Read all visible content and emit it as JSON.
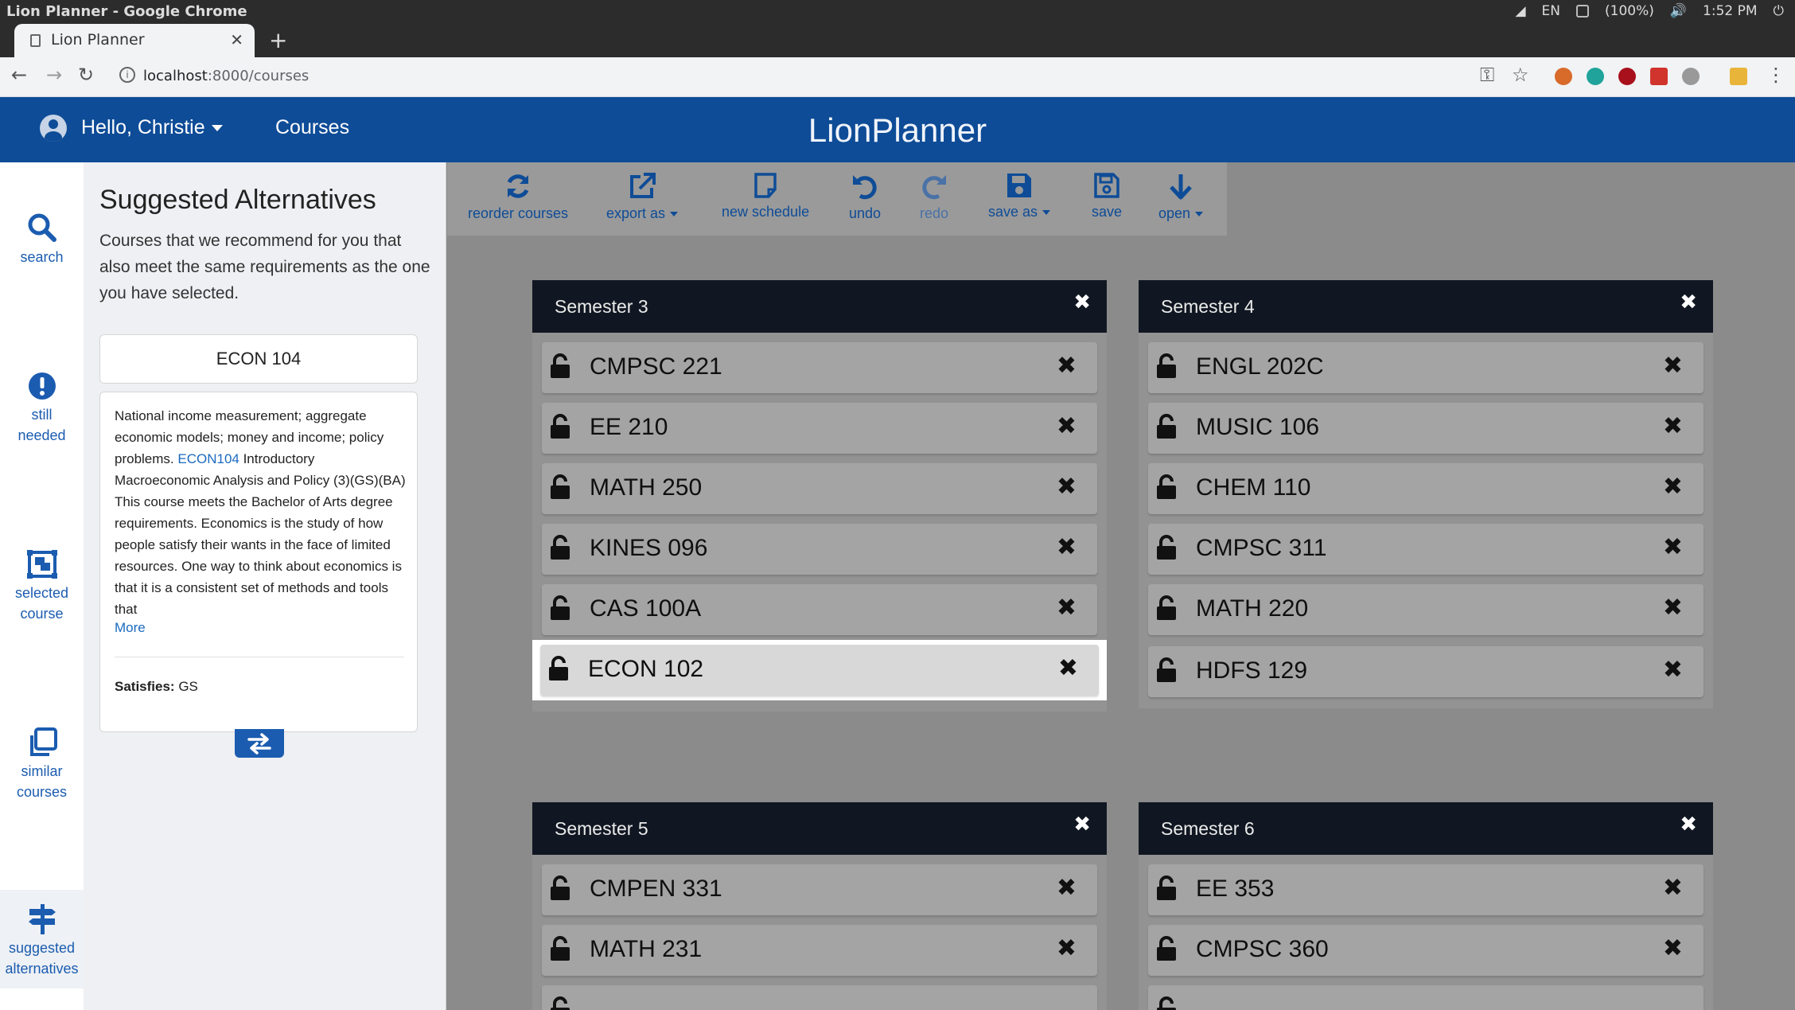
{
  "os": {
    "window_title": "Lion Planner - Google Chrome",
    "lang": "EN",
    "battery": "(100%)",
    "time": "1:52 PM"
  },
  "browser": {
    "tab_title": "Lion Planner",
    "url_host": "localhost",
    "url_path": ":8000/courses"
  },
  "header": {
    "greeting": "Hello, Christie",
    "nav_courses": "Courses",
    "brand": "LionPlanner"
  },
  "rail": {
    "search": "search",
    "still_needed_1": "still",
    "still_needed_2": "needed",
    "selected_1": "selected",
    "selected_2": "course",
    "similar_1": "similar",
    "similar_2": "courses",
    "suggested_1": "suggested",
    "suggested_2": "alternatives"
  },
  "panel": {
    "title": "Suggested Alternatives",
    "subtitle": "Courses that we recommend for you that also meet the same requirements as the one you have selected.",
    "alt_code": "ECON 104",
    "desc_pre": "National income measurement; aggregate economic models; money and income; policy problems. ",
    "desc_link": "ECON104",
    "desc_post": " Introductory Macroeconomic Analysis and Policy (3)(GS)(BA) This course meets the Bachelor of Arts degree requirements. Economics is the study of how people satisfy their wants in the face of limited resources. One way to think about economics is that it is a consistent set of methods and tools that",
    "more": "More",
    "satisfies_label": "Satisfies:",
    "satisfies_value": "GS"
  },
  "tools": {
    "reorder": "reorder courses",
    "export": "export as",
    "new_schedule": "new schedule",
    "undo": "undo",
    "redo": "redo",
    "save_as": "save as",
    "save": "save",
    "open": "open"
  },
  "semesters": {
    "s3": {
      "title": "Semester 3",
      "courses": [
        "CMPSC 221",
        "EE 210",
        "MATH 250",
        "KINES 096",
        "CAS 100A",
        "ECON 102"
      ]
    },
    "s4": {
      "title": "Semester 4",
      "courses": [
        "ENGL 202C",
        "MUSIC 106",
        "CHEM 110",
        "CMPSC 311",
        "MATH 220",
        "HDFS 129"
      ]
    },
    "s5": {
      "title": "Semester 5",
      "courses": [
        "CMPEN 331",
        "MATH 231"
      ]
    },
    "s6": {
      "title": "Semester 6",
      "courses": [
        "EE 353",
        "CMPSC 360"
      ]
    }
  },
  "highlighted_course": "ECON 102",
  "colors": {
    "header_blue": "#0e4c97",
    "semester_header": "#111722",
    "link_blue": "#1b6ac0"
  }
}
